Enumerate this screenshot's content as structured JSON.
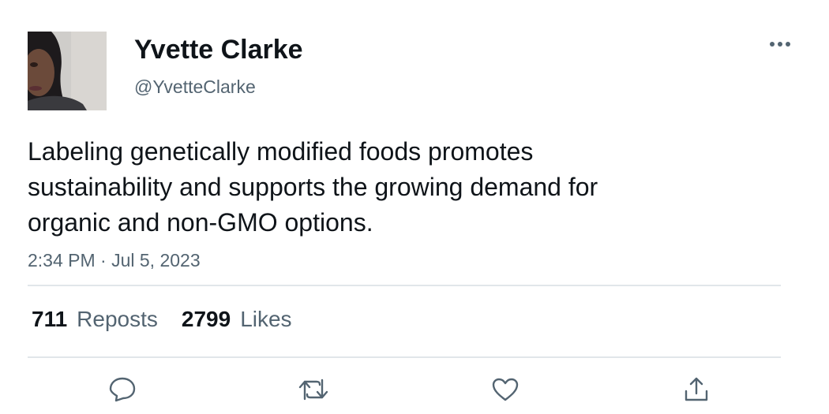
{
  "author": {
    "display_name": "Yvette Clarke",
    "handle": "@YvetteClarke"
  },
  "tweet": {
    "text": "Labeling genetically modified foods promotes\nsustainability and supports the growing demand for\norganic and non-GMO options.",
    "timestamp": "2:34 PM · Jul 5, 2023"
  },
  "stats": {
    "reposts_count": "711",
    "reposts_label": "Reposts",
    "likes_count": "2799",
    "likes_label": "Likes"
  },
  "icons": {
    "more": "more-horizontal-icon",
    "reply": "reply-icon",
    "repost": "repost-icon",
    "like": "heart-icon",
    "share": "share-icon"
  },
  "colors": {
    "text_primary": "#0f1419",
    "text_secondary": "#536471",
    "divider": "#e1e6ea"
  }
}
